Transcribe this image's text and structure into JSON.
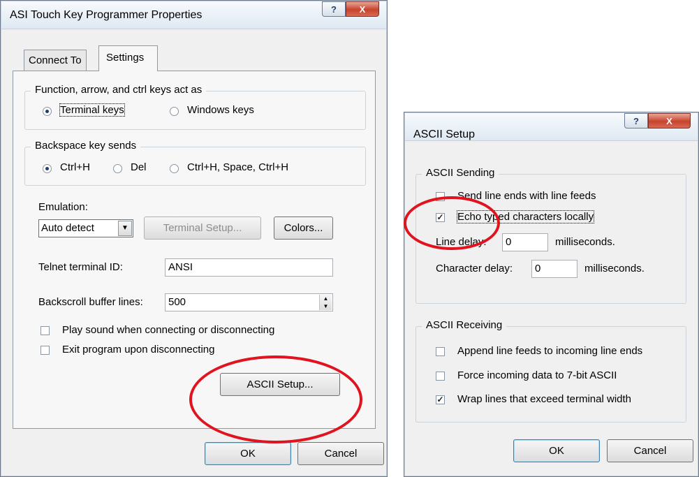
{
  "main_dialog": {
    "title": "ASI Touch Key Programmer Properties",
    "help_glyph": "?",
    "close_glyph": "X",
    "tabs": [
      {
        "label": "Connect To"
      },
      {
        "label": "Settings"
      }
    ],
    "function_keys": {
      "legend": "Function, arrow, and ctrl keys act as",
      "options": [
        {
          "label": "Terminal keys",
          "selected": true
        },
        {
          "label": "Windows keys",
          "selected": false
        }
      ]
    },
    "backspace": {
      "legend": "Backspace key sends",
      "options": [
        {
          "label": "Ctrl+H",
          "selected": true
        },
        {
          "label": "Del",
          "selected": false
        },
        {
          "label": "Ctrl+H, Space, Ctrl+H",
          "selected": false
        }
      ]
    },
    "emulation": {
      "label": "Emulation:",
      "value": "Auto detect",
      "arrow": "▼"
    },
    "terminal_setup_label": "Terminal Setup...",
    "colors_label": "Colors...",
    "telnet": {
      "label": "Telnet terminal ID:",
      "value": "ANSI"
    },
    "backscroll": {
      "label": "Backscroll buffer lines:",
      "value": "500"
    },
    "checkboxes": [
      {
        "label": "Play sound when connecting or disconnecting",
        "checked": false
      },
      {
        "label": "Exit program upon disconnecting",
        "checked": false
      }
    ],
    "ascii_setup_label": "ASCII Setup...",
    "ok_label": "OK",
    "cancel_label": "Cancel"
  },
  "ascii_dialog": {
    "title": "ASCII Setup",
    "help_glyph": "?",
    "close_glyph": "X",
    "sending": {
      "legend": "ASCII Sending",
      "checkboxes": [
        {
          "label": "Send line ends with line feeds",
          "checked": false
        },
        {
          "label": "Echo typed characters locally",
          "checked": true
        }
      ],
      "line_delay": {
        "label": "Line delay:",
        "value": "0",
        "unit": "milliseconds."
      },
      "char_delay": {
        "label": "Character delay:",
        "value": "0",
        "unit": "milliseconds."
      }
    },
    "receiving": {
      "legend": "ASCII Receiving",
      "checkboxes": [
        {
          "label": "Append line feeds to incoming line ends",
          "checked": false
        },
        {
          "label": "Force incoming data to 7-bit ASCII",
          "checked": false
        },
        {
          "label": "Wrap lines that exceed terminal width",
          "checked": true
        }
      ]
    },
    "ok_label": "OK",
    "cancel_label": "Cancel"
  },
  "colors": {
    "highlight_circle": "#e0141e"
  }
}
